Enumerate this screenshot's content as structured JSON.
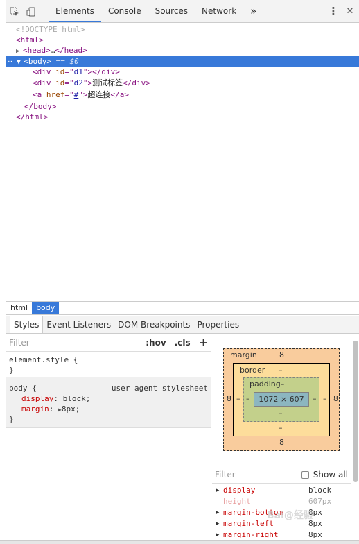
{
  "toolbar": {
    "tabs": [
      "Elements",
      "Console",
      "Sources",
      "Network"
    ],
    "more": "»",
    "menu": "⋮",
    "close": "✕"
  },
  "dom": {
    "doctype": "<!DOCTYPE html>",
    "html_open": "<html>",
    "head": "head",
    "head_ellipsis": "…",
    "body": "body",
    "body_suffix": "== $0",
    "div1_attr": "id",
    "div1_val": "d1",
    "div2_attr": "id",
    "div2_val": "d2",
    "div2_text": "测试标签",
    "a_attr": "href",
    "a_val": "#",
    "a_text": "超连接",
    "body_close": "</body>",
    "html_close": "</html>"
  },
  "breadcrumbs": [
    "html",
    "body"
  ],
  "styles_tabs": [
    "Styles",
    "Event Listeners",
    "DOM Breakpoints",
    "Properties"
  ],
  "filter": {
    "placeholder": "Filter",
    "hov": ":hov",
    "cls": ".cls",
    "add": "+"
  },
  "rules": {
    "element_style": "element.style {",
    "close": "}",
    "body_selector": "body {",
    "body_source": "user agent stylesheet",
    "props": [
      {
        "name": "display",
        "value": "block;"
      },
      {
        "name": "margin",
        "value": "8px;"
      }
    ]
  },
  "box_model": {
    "margin_label": "margin",
    "margin_top": "8",
    "margin_bottom": "8",
    "margin_left": "8",
    "margin_right": "8",
    "border_label": "border",
    "border_top": "–",
    "border_bottom": "–",
    "border_left": "–",
    "border_right": "–",
    "padding_label": "padding–",
    "padding_bottom": "–",
    "padding_left": "–",
    "padding_right": "–",
    "content": "1072 × 607"
  },
  "computed": {
    "placeholder": "Filter",
    "show_all": "Show all",
    "rows": [
      {
        "name": "display",
        "value": "block",
        "dim": false
      },
      {
        "name": "height",
        "value": "607px",
        "dim": true
      },
      {
        "name": "margin-bottom",
        "value": "8px",
        "dim": false
      },
      {
        "name": "margin-left",
        "value": "8px",
        "dim": false
      },
      {
        "name": "margin-right",
        "value": "8px",
        "dim": false
      }
    ]
  },
  "watermark": "Bai@经验"
}
